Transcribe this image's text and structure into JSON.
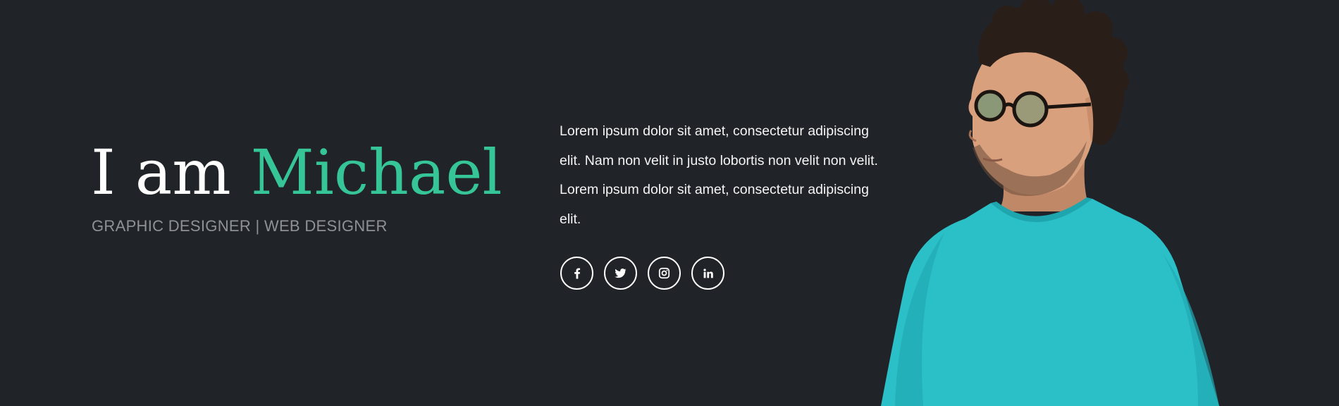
{
  "hero": {
    "greeting": "I am",
    "name": "Michael",
    "subtitle": "GRAPHIC DESIGNER | WEB DESIGNER",
    "intro": "Lorem ipsum dolor sit amet, consectetur adipiscing elit. Nam non velit in justo lobortis non velit non velit. Lorem ipsum dolor sit amet, consectetur adipiscing elit."
  },
  "social": [
    {
      "network": "facebook",
      "icon": "facebook-icon"
    },
    {
      "network": "twitter",
      "icon": "twitter-icon"
    },
    {
      "network": "instagram",
      "icon": "instagram-icon"
    },
    {
      "network": "linkedin",
      "icon": "linkedin-icon"
    }
  ],
  "colors": {
    "background": "#202328",
    "accent": "#36c597",
    "subtitle": "#8e9196",
    "text": "#f4f4f4",
    "shirt": "#2bbfc7"
  }
}
